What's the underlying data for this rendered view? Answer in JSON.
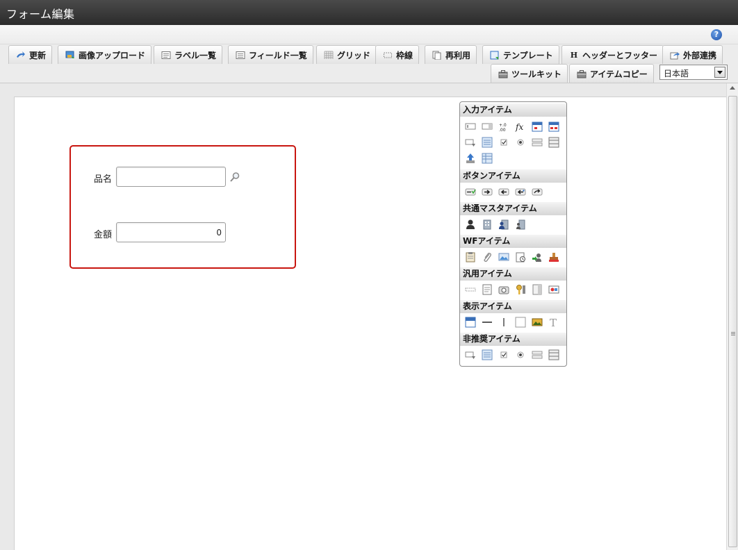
{
  "window": {
    "title": "フォーム編集"
  },
  "help": {
    "icon": "help-icon",
    "glyph": "?"
  },
  "toolbar": {
    "row1": [
      {
        "label": "更新",
        "icon": "update-icon"
      },
      {
        "label": "画像アップロード",
        "icon": "image-upload-icon"
      },
      {
        "label": "ラベル一覧",
        "icon": "label-list-icon"
      },
      {
        "label": "フィールド一覧",
        "icon": "field-list-icon"
      },
      {
        "label": "グリッド",
        "icon": "grid-icon"
      },
      {
        "label": "枠線",
        "icon": "border-icon"
      },
      {
        "label": "再利用",
        "icon": "reuse-icon"
      },
      {
        "label": "テンプレート",
        "icon": "template-icon"
      },
      {
        "label": "ヘッダーとフッター",
        "icon": "header-footer-icon"
      },
      {
        "label": "外部連携",
        "icon": "external-link-icon"
      }
    ],
    "row2": [
      {
        "label": "ツールキット",
        "icon": "toolkit-icon"
      },
      {
        "label": "アイテムコピー",
        "icon": "item-copy-icon"
      }
    ],
    "language": {
      "selected": "日本語"
    }
  },
  "form": {
    "fields": [
      {
        "label": "品名",
        "value": "",
        "has_lookup": true
      },
      {
        "label": "金額",
        "value": "0",
        "has_lookup": false
      }
    ],
    "accent_color": "#c8150f"
  },
  "palette": {
    "sections": [
      {
        "title": "入力アイテム",
        "items": [
          "textbox-icon",
          "textbox-alt-icon",
          "number-icon",
          "formula-icon",
          "date-icon",
          "date-range-icon",
          "combobox-icon",
          "listbox-icon",
          "checkbox-icon",
          "radio-icon",
          "select-list-icon",
          "multi-select-icon",
          "file-upload-icon",
          "table-icon"
        ]
      },
      {
        "title": "ボタンアイテム",
        "items": [
          "button-event-icon",
          "button-next-icon",
          "button-back-icon",
          "button-return-icon",
          "button-forward-icon"
        ]
      },
      {
        "title": "共通マスタアイテム",
        "items": [
          "user-icon",
          "organization-icon",
          "role-icon",
          "public-group-icon"
        ]
      },
      {
        "title": "WFアイテム",
        "items": [
          "wf-document-icon",
          "attachment-icon",
          "image-icon",
          "history-icon",
          "process-icon",
          "stamp-icon"
        ]
      },
      {
        "title": "汎用アイテム",
        "items": [
          "separator-icon",
          "text-doc-icon",
          "camera-icon",
          "key-icon",
          "panel-icon",
          "widget-icon"
        ]
      },
      {
        "title": "表示アイテム",
        "items": [
          "label-icon",
          "horizontal-line-icon",
          "vertical-line-icon",
          "frame-icon",
          "picture-icon",
          "text-icon"
        ]
      },
      {
        "title": "非推奨アイテム",
        "items": [
          "combobox-old-icon",
          "listbox-old-icon",
          "checkbox-old-icon",
          "radio-old-icon",
          "select-old-icon",
          "multi-select-old-icon"
        ]
      }
    ]
  }
}
